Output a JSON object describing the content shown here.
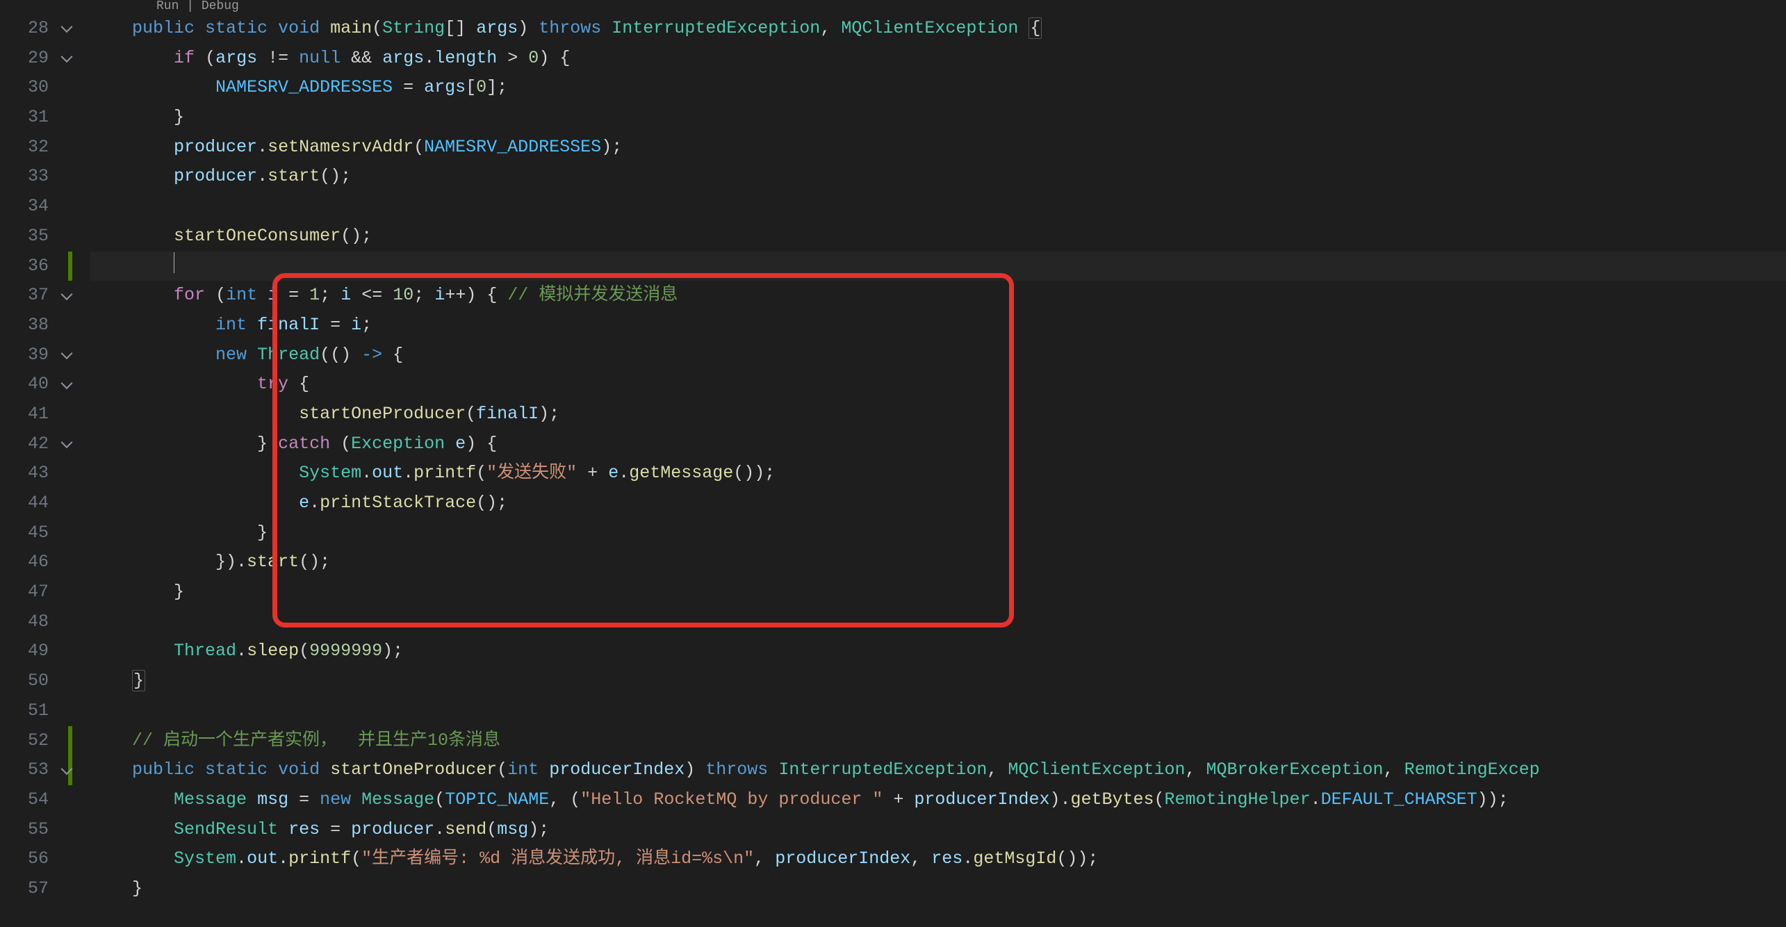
{
  "codelens": {
    "run": "Run",
    "sep": " | ",
    "debug": "Debug"
  },
  "lines": {
    "start": 28,
    "end": 57,
    "foldable": [
      28,
      29,
      37,
      39,
      40,
      42,
      53
    ],
    "greenmark": [
      36,
      52,
      53
    ],
    "highlighted": 36
  },
  "t": {
    "public": "public",
    "static": "static",
    "void": "void",
    "main": "main",
    "String": "String",
    "args": "args",
    "throws": "throws",
    "InterruptedException": "InterruptedException",
    "MQClientException": "MQClientException",
    "MQBrokerException": "MQBrokerException",
    "RemotingExcep": "RemotingExcep",
    "if": "if",
    "null": "null",
    "length": "length",
    "NAMESRV_ADDRESSES": "NAMESRV_ADDRESSES",
    "producer": "producer",
    "setNamesrvAddr": "setNamesrvAddr",
    "start": "start",
    "startOneConsumer": "startOneConsumer",
    "for": "for",
    "int": "int",
    "i": "i",
    "finalI": "finalI",
    "cmt_for": "// 模拟并发发送消息",
    "new": "new",
    "Thread": "Thread",
    "try": "try",
    "catch": "catch",
    "Exception": "Exception",
    "e": "e",
    "startOneProducer": "startOneProducer",
    "System": "System",
    "out": "out",
    "printf": "printf",
    "str1": "\"发送失败\"",
    "getMessage": "getMessage",
    "printStackTrace": "printStackTrace",
    "sleep": "sleep",
    "n9999999": "9999999",
    "cmt_prod": "// 启动一个生产者实例，  并且生产10条消息",
    "producerIndex": "producerIndex",
    "Message": "Message",
    "msg": "msg",
    "TOPIC_NAME": "TOPIC_NAME",
    "str_hello": "\"Hello RocketMQ by producer \"",
    "getBytes": "getBytes",
    "RemotingHelper": "RemotingHelper",
    "DEFAULT_CHARSET": "DEFAULT_CHARSET",
    "SendResult": "SendResult",
    "res": "res",
    "send": "send",
    "str_fmt": "\"生产者编号: %d 消息发送成功, 消息id=%s\\n\"",
    "getMsgId": "getMsgId",
    "n1": "1",
    "n10": "10",
    "n0": "0"
  },
  "annotation": {
    "highlight_box": {
      "purpose": "red rectangle annotation drawn over lines 37-48"
    }
  }
}
